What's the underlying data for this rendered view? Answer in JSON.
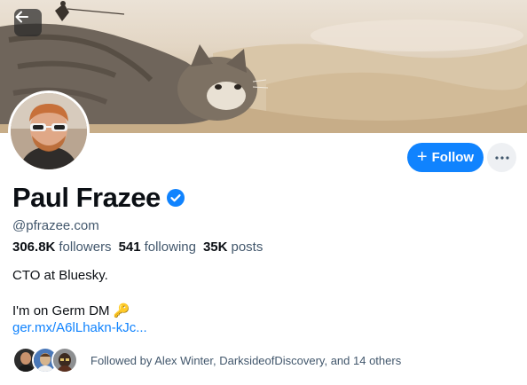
{
  "header": {
    "back_icon": "arrow-left-icon",
    "banner_description_icon": "cat-desert-banner"
  },
  "actions": {
    "follow_label": "Follow",
    "follow_icon": "plus-icon",
    "more_icon": "ellipsis-icon",
    "accent_color": "#1083fe"
  },
  "profile": {
    "display_name": "Paul Frazee",
    "verified_icon": "verified-check-icon",
    "handle": "@pfrazee.com",
    "stats": [
      {
        "value": "306.8K",
        "label": "followers"
      },
      {
        "value": "541",
        "label": "following"
      },
      {
        "value": "35K",
        "label": "posts"
      }
    ],
    "bio_line1": "CTO at Bluesky.",
    "bio_line2": "I'm on Germ DM",
    "bio_emoji": "🔑",
    "bio_link": "ger.mx/A6lLhakn-kJc..."
  },
  "followed_by": {
    "text": "Followed by Alex Winter, DarksideofDiscovery, and 14 others"
  }
}
